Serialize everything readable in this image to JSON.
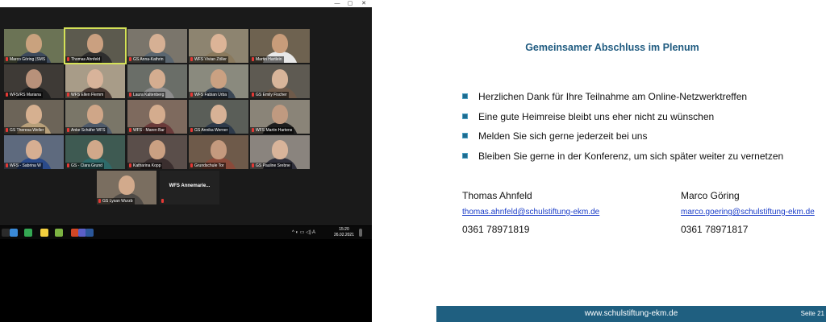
{
  "call": {
    "window_controls": [
      "—",
      "▢",
      "✕"
    ],
    "tiles": [
      {
        "name": "Marco Göring (SMS",
        "bg": "#6b7355",
        "skin": "#c9a27e",
        "shirt": "#3d4a5c"
      },
      {
        "name": "Thomas Ahnfeld",
        "bg": "#5c5a4e",
        "skin": "#caa080",
        "shirt": "#2e2e2e",
        "speaking": true
      },
      {
        "name": "GS Anna-Kathrin",
        "bg": "#7a756b",
        "skin": "#d6b094",
        "shirt": "#5a6670"
      },
      {
        "name": "WFS Vivian Zöller",
        "bg": "#8d8470",
        "skin": "#dcb497",
        "shirt": "#8a7a5e"
      },
      {
        "name": "Martin Hartlein",
        "bg": "#6e6250",
        "skin": "#c89c7a",
        "shirt": "#e8e8e8"
      },
      {
        "name": "WFS/RS Mariana",
        "bg": "#3e3a36",
        "skin": "#b8917a",
        "shirt": "#1e1e1e"
      },
      {
        "name": "WFS Ellen Flemm",
        "bg": "#a89c88",
        "skin": "#d8b39a",
        "shirt": "#4a3a34"
      },
      {
        "name": "Laura Kaltenberg",
        "bg": "#6a6e68",
        "skin": "#d4ad90",
        "shirt": "#8c8c8c"
      },
      {
        "name": "WFS Fabian Urba",
        "bg": "#8a8a7e",
        "skin": "#caa182",
        "shirt": "#3a4654"
      },
      {
        "name": "GS Emily Fischer",
        "bg": "#5e5a52",
        "skin": "#d8b59a",
        "shirt": "#6e5a4a"
      },
      {
        "name": "GS Theresa Weller",
        "bg": "#6c6458",
        "skin": "#d6b090",
        "shirt": "#b8a07a"
      },
      {
        "name": "Anke Schäfer WFS",
        "bg": "#7a7668",
        "skin": "#cfa688",
        "shirt": "#4e5a6a"
      },
      {
        "name": "WFS - Maren Bar",
        "bg": "#7e6a5e",
        "skin": "#d4ac8e",
        "shirt": "#6a3a3a"
      },
      {
        "name": "GS Annika Werner",
        "bg": "#5a5e58",
        "skin": "#d8b296",
        "shirt": "#2e3a4a"
      },
      {
        "name": "WFS Martin Hartens",
        "bg": "#8a8478",
        "skin": "#c09a80",
        "shirt": "#1e1e1e"
      },
      {
        "name": "WFS - Sabrina W",
        "bg": "#5e6a7e",
        "skin": "#d6ae92",
        "shirt": "#2a4a8a"
      },
      {
        "name": "GS - Clara Grund",
        "bg": "#3e5a52",
        "skin": "#d0a88a",
        "shirt": "#2e6a6a"
      },
      {
        "name": "Katharina Kopp",
        "bg": "#5a4e4a",
        "skin": "#caa082",
        "shirt": "#3a2e2e"
      },
      {
        "name": "Grundschule Tor",
        "bg": "#6e5a4a",
        "skin": "#c49a7e",
        "shirt": "#8a4a3a"
      },
      {
        "name": "GS Pauline Srebne",
        "bg": "#8a847e",
        "skin": "#d8b49a",
        "shirt": "#2e2e3a"
      },
      {
        "name": "GS Lysan Wurzb",
        "bg": "#7a6e60",
        "skin": "#d2aa8c",
        "shirt": "#4e4a46"
      }
    ],
    "plain_tile": {
      "label": "WFS  Annemarie..."
    }
  },
  "taskbar": {
    "clock_time": "15:20",
    "clock_date": "26.02.2021",
    "tray_text": "^ ◐ ▭ ◁) A",
    "apps": [
      {
        "icon": "explorer-icon",
        "color": "#3a8ad8"
      },
      {
        "icon": "chrome-icon",
        "color": "#34a853"
      },
      {
        "icon": "sticky-notes-icon",
        "color": "#f4d03f"
      },
      {
        "icon": "camera-app-icon",
        "color": "#7cb342"
      },
      {
        "icon": "powerpoint-icon",
        "color": "#d24726"
      },
      {
        "icon": "teams-icon",
        "color": "#5b5fc7"
      },
      {
        "icon": "word-icon",
        "color": "#2b579a"
      }
    ]
  },
  "slide": {
    "title": "Gemeinsamer Abschluss im Plenum",
    "bullets": [
      "Herzlichen Dank für Ihre Teilnahme am Online-Netzwerktreffen",
      "Eine gute Heimreise bleibt uns eher nicht zu wünschen",
      "Melden Sie sich gerne jederzeit bei uns",
      "Bleiben Sie gerne in der Konferenz, um sich später weiter zu vernetzen"
    ],
    "contacts": [
      {
        "name": "Thomas Ahnfeld",
        "email": "thomas.ahnfeld@schulstiftung-ekm.de",
        "phone": "0361 78971819"
      },
      {
        "name": "Marco Göring",
        "email": "marco.goering@schulstiftung-ekm.de",
        "phone": "0361 78971817"
      }
    ],
    "footer_url": "www.schulstiftung-ekm.de",
    "page_label": "Seite 21",
    "accent_color": "#1f5f80"
  }
}
